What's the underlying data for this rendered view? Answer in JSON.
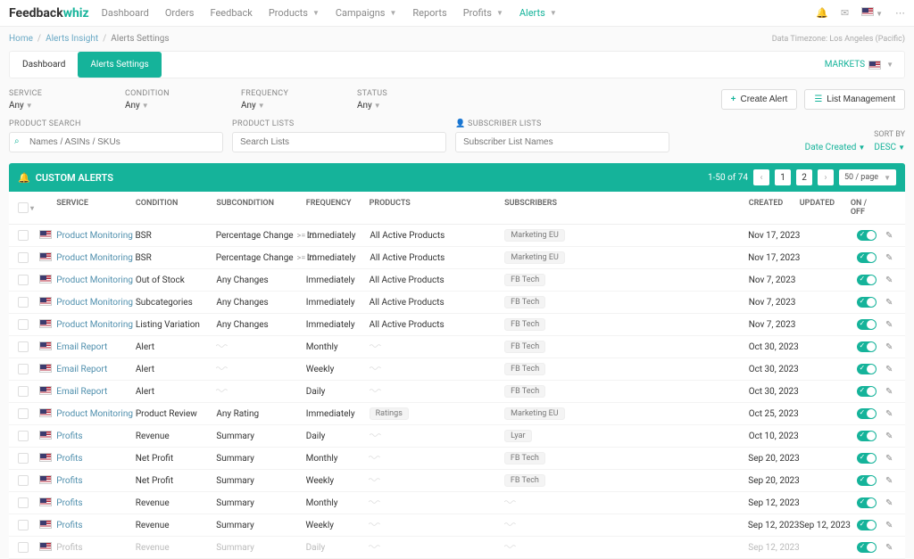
{
  "logo": {
    "part1": "Feedback",
    "part2": "whiz"
  },
  "nav": [
    {
      "label": "Dashboard",
      "dd": false
    },
    {
      "label": "Orders",
      "dd": false
    },
    {
      "label": "Feedback",
      "dd": false
    },
    {
      "label": "Products",
      "dd": true
    },
    {
      "label": "Campaigns",
      "dd": true
    },
    {
      "label": "Reports",
      "dd": false
    },
    {
      "label": "Profits",
      "dd": true
    },
    {
      "label": "Alerts",
      "dd": true,
      "active": true
    }
  ],
  "breadcrumb": {
    "home": "Home",
    "insight": "Alerts Insight",
    "settings": "Alerts Settings"
  },
  "timezone": "Data Timezone: Los Angeles (Pacific)",
  "tabs": {
    "dashboard": "Dashboard",
    "settings": "Alerts Settings",
    "markets": "MARKETS"
  },
  "filters": {
    "service": {
      "label": "SERVICE",
      "value": "Any"
    },
    "condition": {
      "label": "CONDITION",
      "value": "Any"
    },
    "frequency": {
      "label": "FREQUENCY",
      "value": "Any"
    },
    "status": {
      "label": "STATUS",
      "value": "Any"
    }
  },
  "buttons": {
    "create": "Create Alert",
    "list": "List Management"
  },
  "search": {
    "product": {
      "label": "PRODUCT SEARCH",
      "placeholder": "Names / ASINs / SKUs"
    },
    "lists": {
      "label": "PRODUCT LISTS",
      "placeholder": "Search Lists"
    },
    "subs": {
      "label": "SUBSCRIBER LISTS",
      "placeholder": "Subscriber List Names"
    }
  },
  "sort": {
    "label": "SORT BY",
    "field": "Date Created",
    "dir": "DESC"
  },
  "tableHeader": {
    "title": "CUSTOM ALERTS",
    "range": "1-50 of 74",
    "p1": "1",
    "p2": "2",
    "perPage": "50 / page"
  },
  "columns": {
    "service": "SERVICE",
    "condition": "CONDITION",
    "sub": "SUBCONDITION",
    "freq": "FREQUENCY",
    "products": "PRODUCTS",
    "subscribers": "SUBSCRIBERS",
    "created": "CREATED",
    "updated": "UPDATED",
    "onoff": "ON / OFF"
  },
  "rows": [
    {
      "service": "Product Monitoring",
      "condition": "BSR",
      "sub": "Percentage Change",
      "subExtra": ">= 20",
      "freq": "Immediately",
      "products": "All Active Products",
      "subscribers": "Marketing EU",
      "created": "Nov 17, 2023",
      "updated": ""
    },
    {
      "service": "Product Monitoring",
      "condition": "BSR",
      "sub": "Percentage Change",
      "subExtra": ">= 20",
      "freq": "Immediately",
      "products": "All Active Products",
      "subscribers": "Marketing EU",
      "created": "Nov 17, 2023",
      "updated": ""
    },
    {
      "service": "Product Monitoring",
      "condition": "Out of Stock",
      "sub": "Any Changes",
      "freq": "Immediately",
      "products": "All Active Products",
      "subscribers": "FB Tech",
      "created": "Nov 7, 2023",
      "updated": ""
    },
    {
      "service": "Product Monitoring",
      "condition": "Subcategories",
      "sub": "Any Changes",
      "freq": "Immediately",
      "products": "All Active Products",
      "subscribers": "FB Tech",
      "created": "Nov 7, 2023",
      "updated": ""
    },
    {
      "service": "Product Monitoring",
      "condition": "Listing Variation",
      "sub": "Any Changes",
      "freq": "Immediately",
      "products": "All Active Products",
      "subscribers": "FB Tech",
      "created": "Nov 7, 2023",
      "updated": ""
    },
    {
      "service": "Email Report",
      "condition": "Alert",
      "sub": "~",
      "freq": "Monthly",
      "products": "~",
      "subscribers": "FB Tech",
      "created": "Oct 30, 2023",
      "updated": ""
    },
    {
      "service": "Email Report",
      "condition": "Alert",
      "sub": "~",
      "freq": "Weekly",
      "products": "~",
      "subscribers": "FB Tech",
      "created": "Oct 30, 2023",
      "updated": ""
    },
    {
      "service": "Email Report",
      "condition": "Alert",
      "sub": "~",
      "freq": "Daily",
      "products": "~",
      "subscribers": "FB Tech",
      "created": "Oct 30, 2023",
      "updated": ""
    },
    {
      "service": "Product Monitoring",
      "condition": "Product Review",
      "sub": "Any Rating",
      "freq": "Immediately",
      "products": "Ratings",
      "productsTag": true,
      "subscribers": "Marketing EU",
      "created": "Oct 25, 2023",
      "updated": ""
    },
    {
      "service": "Profits",
      "condition": "Revenue",
      "sub": "Summary",
      "freq": "Daily",
      "products": "~",
      "subscribers": "Lyar",
      "created": "Oct 10, 2023",
      "updated": ""
    },
    {
      "service": "Profits",
      "condition": "Net Profit",
      "sub": "Summary",
      "freq": "Monthly",
      "products": "~",
      "subscribers": "FB Tech",
      "created": "Sep 20, 2023",
      "updated": ""
    },
    {
      "service": "Profits",
      "condition": "Net Profit",
      "sub": "Summary",
      "freq": "Weekly",
      "products": "~",
      "subscribers": "FB Tech",
      "created": "Sep 20, 2023",
      "updated": ""
    },
    {
      "service": "Profits",
      "condition": "Revenue",
      "sub": "Summary",
      "freq": "Monthly",
      "products": "~",
      "subscribers": "~",
      "created": "Sep 12, 2023",
      "updated": ""
    },
    {
      "service": "Profits",
      "condition": "Revenue",
      "sub": "Summary",
      "freq": "Weekly",
      "products": "~",
      "subscribers": "~",
      "created": "Sep 12, 2023",
      "updated": "Sep 12, 2023"
    },
    {
      "service": "Profits",
      "condition": "Revenue",
      "sub": "Summary",
      "freq": "Daily",
      "products": "~",
      "subscribers": "~",
      "created": "Sep 12, 2023",
      "updated": "",
      "muted": true
    }
  ]
}
